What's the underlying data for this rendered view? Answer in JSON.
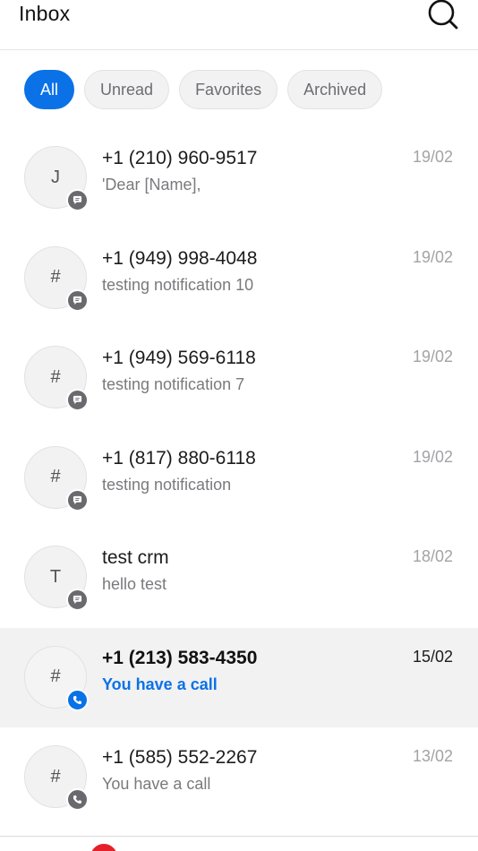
{
  "header": {
    "title": "Inbox",
    "search_icon": "search-icon"
  },
  "filters": [
    {
      "label": "All",
      "active": true
    },
    {
      "label": "Unread",
      "active": false
    },
    {
      "label": "Favorites",
      "active": false
    },
    {
      "label": "Archived",
      "active": false
    }
  ],
  "conversations": [
    {
      "initial": "J",
      "name": "+1 (210) 960-9517",
      "preview": "'Dear [Name],",
      "date": "19/02",
      "type": "message",
      "unread": false
    },
    {
      "initial": "#",
      "name": "+1 (949) 998-4048",
      "preview": "testing notification 10",
      "date": "19/02",
      "type": "message",
      "unread": false
    },
    {
      "initial": "#",
      "name": "+1 (949) 569-6118",
      "preview": "testing notification 7",
      "date": "19/02",
      "type": "message",
      "unread": false
    },
    {
      "initial": "#",
      "name": "+1 (817) 880-6118",
      "preview": "testing notification",
      "date": "19/02",
      "type": "message",
      "unread": false
    },
    {
      "initial": "T",
      "name": "test crm",
      "preview": "hello test",
      "date": "18/02",
      "type": "message",
      "unread": false
    },
    {
      "initial": "#",
      "name": "+1 (213) 583-4350",
      "preview": "You have a call",
      "date": "15/02",
      "type": "call",
      "unread": true
    },
    {
      "initial": "#",
      "name": "+1 (585) 552-2267",
      "preview": "You have a call",
      "date": "13/02",
      "type": "call",
      "unread": false
    }
  ],
  "colors": {
    "accent": "#0a72e6",
    "notification_dot": "#e5202a"
  }
}
